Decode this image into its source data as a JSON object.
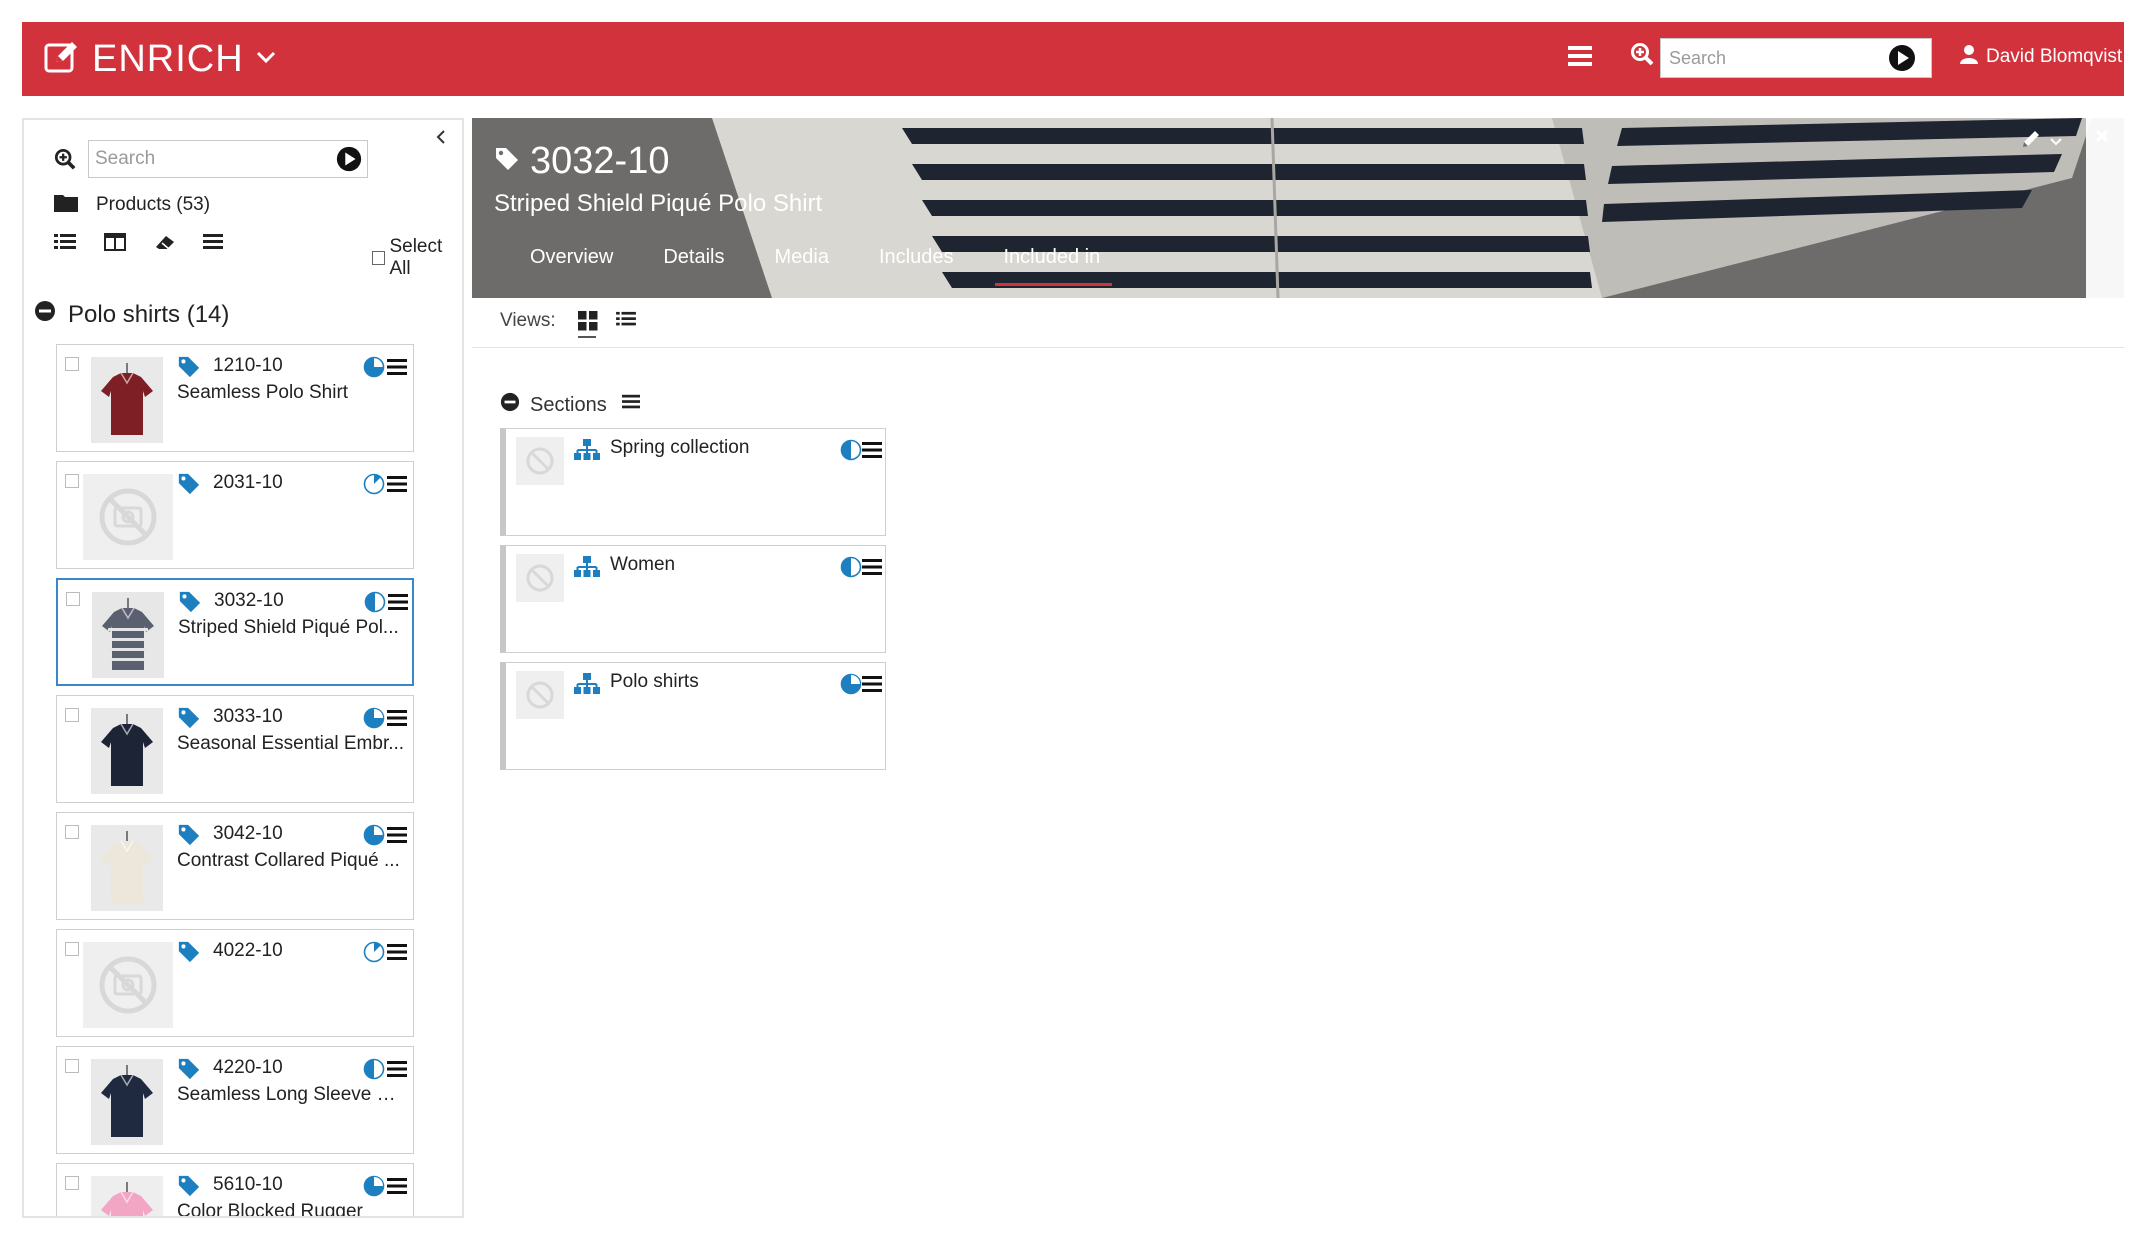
{
  "app": {
    "brand": "ENRICH",
    "accent": "#d2323c",
    "link_blue": "#1d7fc0"
  },
  "header": {
    "search_placeholder": "Search",
    "user_name": "David Blomqvist"
  },
  "sidebar": {
    "search_placeholder": "Search",
    "products_label": "Products (53)",
    "select_all_label": "Select All",
    "group_label": "Polo shirts (14)",
    "items": [
      {
        "code": "1210-10",
        "name": "Seamless Polo Shirt",
        "status": "three-quarter"
      },
      {
        "code": "2031-10",
        "name": "",
        "status": "eighth"
      },
      {
        "code": "3032-10",
        "name": "Striped Shield Piqué Pol...",
        "status": "half",
        "selected": true
      },
      {
        "code": "3033-10",
        "name": "Seasonal Essential Embr...",
        "status": "three-quarter-full"
      },
      {
        "code": "3042-10",
        "name": "Contrast Collared Piqué ...",
        "status": "three-quarter"
      },
      {
        "code": "4022-10",
        "name": "",
        "status": "eighth"
      },
      {
        "code": "4220-10",
        "name": "Seamless Long Sleeve Po...",
        "status": "half"
      },
      {
        "code": "5610-10",
        "name": "Color Blocked Rugger",
        "status": "three-quarter-full"
      }
    ]
  },
  "detail": {
    "code": "3032-10",
    "name": "Striped Shield Piqué Polo Shirt",
    "tabs": [
      "Overview",
      "Details",
      "Media",
      "Includes",
      "Included in"
    ],
    "active_tab": "Included in",
    "views_label": "Views:",
    "sections_label": "Sections",
    "sections": [
      {
        "name": "Spring collection",
        "status": "half"
      },
      {
        "name": "Women",
        "status": "half"
      },
      {
        "name": "Polo shirts",
        "status": "three-quarter-full"
      }
    ]
  }
}
